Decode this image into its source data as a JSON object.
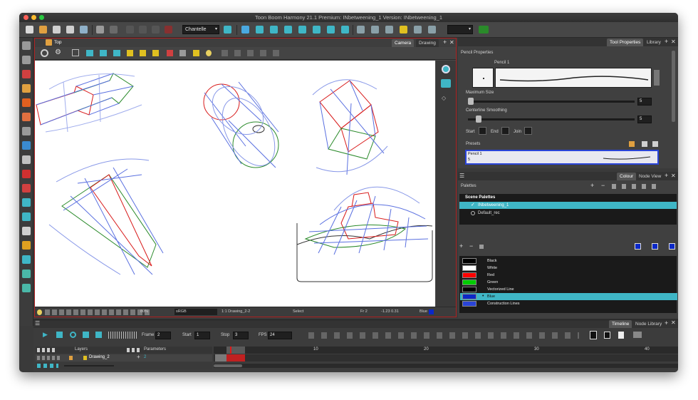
{
  "window": {
    "title": "Toon Boom Harmony 21.1 Premium: INbetweening_1 Version: INbetweening_1"
  },
  "toolbar": {
    "brush_preset": "Chantelle"
  },
  "view": {
    "tabs": [
      "Camera",
      "Drawing"
    ],
    "active_tab": "Camera",
    "breadcrumb": "Top",
    "status": {
      "zoom": "80%",
      "color_space": "sRGB",
      "drawing": "1:1  Drawing_2-2",
      "tool": "Select",
      "frame": "Fr 2",
      "coords": "-1.23 0.31",
      "color": "Blue"
    }
  },
  "tool_properties": {
    "tabs": [
      "Tool Properties",
      "Library"
    ],
    "section": "Pencil Properties",
    "pencil_name": "Pencil 1",
    "max_size_label": "Maximum Size",
    "max_size_value": "5",
    "smoothing_label": "Centerline Smoothing",
    "smoothing_value": "5",
    "start_label": "Start",
    "end_label": "End",
    "join_label": "Join",
    "presets_label": "Presets",
    "preset_item": "Pencil 1",
    "preset_value": "5"
  },
  "colour": {
    "tabs": [
      "Colour",
      "Node View"
    ],
    "palettes_label": "Palettes",
    "scene_palettes": "Scene Palettes",
    "palettes": [
      "INbetweening_1",
      "Default_rec"
    ],
    "swatches": [
      {
        "name": "Black",
        "color": "#000000"
      },
      {
        "name": "White",
        "color": "#ffffff"
      },
      {
        "name": "Red",
        "color": "#ff0000"
      },
      {
        "name": "Green",
        "color": "#00cc00"
      },
      {
        "name": "Vectorized Line",
        "color": "#000000"
      },
      {
        "name": "Blue",
        "color": "#0b28c8"
      },
      {
        "name": "Construction Lines",
        "color": "#2a44d8"
      }
    ],
    "selected_swatch": "Blue"
  },
  "timeline": {
    "tabs": [
      "Timeline",
      "Node Library"
    ],
    "frame_label": "Frame",
    "frame_value": "2",
    "start_label": "Start",
    "start_value": "1",
    "stop_label": "Stop",
    "stop_value": "3",
    "fps_label": "FPS",
    "fps_value": "24",
    "layers_header": "Layers",
    "params_header": "Parameters",
    "layer_name": "Drawing_2",
    "layer_param": "2",
    "ruler": [
      "10",
      "20",
      "30",
      "40"
    ]
  },
  "accent": "#b02020",
  "selection_color": "#3fb6c6"
}
